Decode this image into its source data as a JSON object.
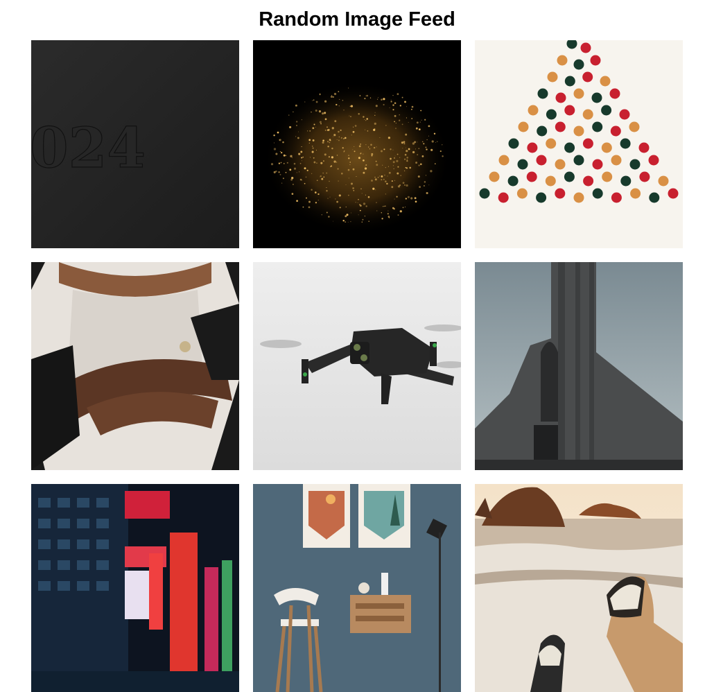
{
  "page": {
    "title": "Random Image Feed"
  },
  "feed": {
    "images": [
      {
        "subject": "dark-embossed-number",
        "text": "024"
      },
      {
        "subject": "golden-glitter-sparkles"
      },
      {
        "subject": "colorful-dots-triangle"
      },
      {
        "subject": "wedding-couple-hands"
      },
      {
        "subject": "flying-drone"
      },
      {
        "subject": "concrete-church-tower"
      },
      {
        "subject": "neon-city-night-street"
      },
      {
        "subject": "interior-wall-posters-chair"
      },
      {
        "subject": "beach-feet-sneakers"
      }
    ]
  }
}
